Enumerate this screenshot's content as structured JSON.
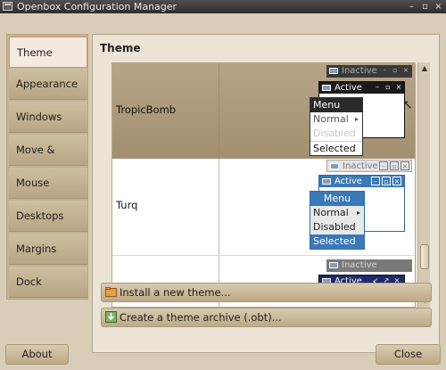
{
  "window": {
    "title": "Openbox Configuration Manager"
  },
  "titlebar_buttons": [
    "–",
    "▫",
    "×"
  ],
  "sidebar": {
    "items": [
      {
        "label": "Theme",
        "active": true
      },
      {
        "label": "Appearance"
      },
      {
        "label": "Windows"
      },
      {
        "label": "Move & Resize"
      },
      {
        "label": "Mouse"
      },
      {
        "label": "Desktops"
      },
      {
        "label": "Margins"
      },
      {
        "label": "Dock"
      }
    ]
  },
  "main": {
    "title": "Theme",
    "themes": [
      {
        "name": "TropicBomb",
        "selected": true,
        "preview": {
          "inactive": "Inactive",
          "active": "Active",
          "menu": {
            "title": "Menu",
            "items": [
              "Normal",
              "Disabled",
              "Selected"
            ]
          }
        }
      },
      {
        "name": "Turq",
        "selected": false,
        "preview": {
          "inactive": "Inactive",
          "active": "Active",
          "menu": {
            "title": "Menu",
            "items": [
              "Normal",
              "Disabled",
              "Selected"
            ]
          }
        }
      },
      {
        "name": "",
        "selected": false,
        "preview": {
          "inactive": "Inactive",
          "active": "Active"
        }
      }
    ],
    "install_button": "Install a new theme...",
    "archive_button": "Create a theme archive (.obt)..."
  },
  "footer": {
    "about": "About",
    "close": "Close"
  }
}
